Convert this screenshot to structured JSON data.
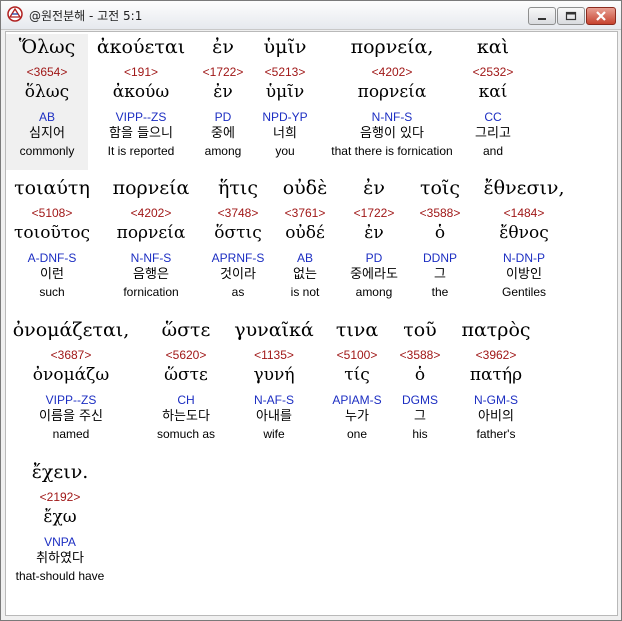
{
  "window": {
    "title": "@원전분해 - 고전 5:1",
    "controls": {
      "minimize": "minimize",
      "maximize": "maximize",
      "close": "close"
    }
  },
  "colors": {
    "strong": "#a01818",
    "parsing": "#1c2ec2",
    "text": "#000000",
    "highlight": "#f0f0f0"
  },
  "rows": [
    [
      {
        "greek": "Ὅλως",
        "num": "<3654>",
        "lemma": "ὅλως",
        "parse": "AB",
        "kor": "심지어",
        "eng": "commonly"
      },
      {
        "greek": "ἀκούεται",
        "num": "<191>",
        "lemma": "ἀκούω",
        "parse": "VIPP--ZS",
        "kor": "함을 들으니",
        "eng": "It is reported"
      },
      {
        "greek": "ἐν",
        "num": "<1722>",
        "lemma": "ἐν",
        "parse": "PD",
        "kor": "중에",
        "eng": "among"
      },
      {
        "greek": "ὑμῖν",
        "num": "<5213>",
        "lemma": "ὑμῖν",
        "parse": "NPD-YP",
        "kor": "너희",
        "eng": "you"
      },
      {
        "greek": "πορνεία,",
        "num": "<4202>",
        "lemma": "πορνεία",
        "parse": "N-NF-S",
        "kor": "음행이 있다",
        "eng": "that there is fornication"
      },
      {
        "greek": "καὶ",
        "num": "<2532>",
        "lemma": "καί",
        "parse": "CC",
        "kor": "그리고",
        "eng": "and"
      }
    ],
    [
      {
        "greek": "τοιαύτη",
        "num": "<5108>",
        "lemma": "τοιοῦτος",
        "parse": "A-DNF-S",
        "kor": "이런",
        "eng": "such"
      },
      {
        "greek": "πορνεία",
        "num": "<4202>",
        "lemma": "πορνεία",
        "parse": "N-NF-S",
        "kor": "음행은",
        "eng": "fornication"
      },
      {
        "greek": "ἥτις",
        "num": "<3748>",
        "lemma": "ὅστις",
        "parse": "APRNF-S",
        "kor": "것이라",
        "eng": "as"
      },
      {
        "greek": "οὐδὲ",
        "num": "<3761>",
        "lemma": "οὐδέ",
        "parse": "AB",
        "kor": "없는",
        "eng": "is not"
      },
      {
        "greek": "ἐν",
        "num": "<1722>",
        "lemma": "ἐν",
        "parse": "PD",
        "kor": "중에라도",
        "eng": "among"
      },
      {
        "greek": "τοῖς",
        "num": "<3588>",
        "lemma": "ὁ",
        "parse": "DDNP",
        "kor": "그",
        "eng": "the"
      },
      {
        "greek": "ἔθνεσιν,",
        "num": "<1484>",
        "lemma": "ἔθνος",
        "parse": "N-DN-P",
        "kor": "이방인",
        "eng": "Gentiles"
      }
    ],
    [
      {
        "greek": "ὀνομάζεται,",
        "num": "<3687>",
        "lemma": "ὀνομάζω",
        "parse": "VIPP--ZS",
        "kor": "이름을 주신",
        "eng": "named"
      },
      {
        "greek": "ὥστε",
        "num": "<5620>",
        "lemma": "ὥστε",
        "parse": "CH",
        "kor": "하는도다",
        "eng": "somuch as"
      },
      {
        "greek": "γυναῖκά",
        "num": "<1135>",
        "lemma": "γυνή",
        "parse": "N-AF-S",
        "kor": "아내를",
        "eng": "wife"
      },
      {
        "greek": "τινα",
        "num": "<5100>",
        "lemma": "τίς",
        "parse": "APIAM-S",
        "kor": "누가",
        "eng": "one"
      },
      {
        "greek": "τοῦ",
        "num": "<3588>",
        "lemma": "ὁ",
        "parse": "DGMS",
        "kor": "그",
        "eng": "his"
      },
      {
        "greek": "πατρὸς",
        "num": "<3962>",
        "lemma": "πατήρ",
        "parse": "N-GM-S",
        "kor": "아비의",
        "eng": "father's"
      }
    ],
    [
      {
        "greek": "ἔχειν.",
        "num": "<2192>",
        "lemma": "ἔχω",
        "parse": "VNPA",
        "kor": "취하였다",
        "eng": "that-should have"
      }
    ]
  ]
}
